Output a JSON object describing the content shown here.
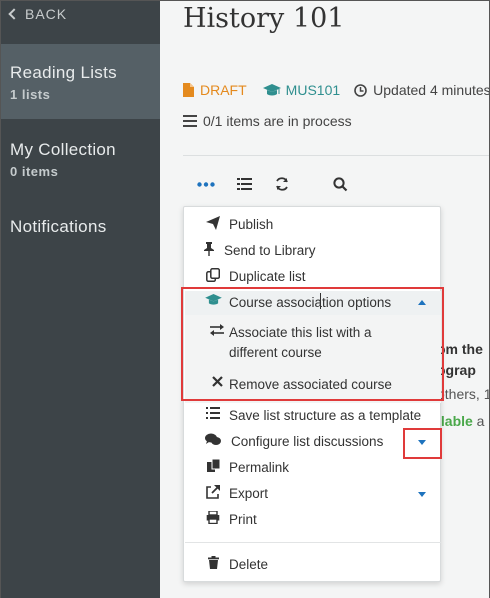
{
  "sidebar": {
    "back_label": "BACK",
    "items": [
      {
        "title": "Reading Lists",
        "sub": "1 lists"
      },
      {
        "title": "My Collection",
        "sub": "0 items"
      },
      {
        "title": "Notifications",
        "sub": ""
      }
    ]
  },
  "page": {
    "title": "History 101",
    "status": "DRAFT",
    "course_code": "MUS101",
    "updated": "Updated 4 minutes",
    "process_text": "0/1 items are in process"
  },
  "behind_text": {
    "line1": "om the",
    "line2": "ograp",
    "line3": "others, 1",
    "line4a": "ilable",
    "line4b": " a"
  },
  "menu": {
    "publish": "Publish",
    "send_to_library": "Send to Library",
    "duplicate_list": "Duplicate list",
    "course_association_options": "Course association options",
    "associate_line1": "Associate this list with a",
    "associate_line2": "different course",
    "remove_course": "Remove associated course",
    "save_template": "Save list structure as a template",
    "configure_discussions": "Configure list discussions",
    "permalink": "Permalink",
    "export": "Export",
    "print": "Print",
    "delete": "Delete"
  },
  "colors": {
    "sidebar_bg": "#3d4448",
    "sidebar_active": "#556066",
    "draft_orange": "#e48a1e",
    "course_teal": "#2f8f8f",
    "accent_blue": "#1e73be",
    "highlight_red": "#e03a3a"
  },
  "icons": [
    "chevron-left-icon",
    "file-icon",
    "graduation-cap-icon",
    "clock-icon",
    "list-icon",
    "ellipsis-icon",
    "refresh-icon",
    "search-icon",
    "paper-plane-icon",
    "pin-icon",
    "copy-icon",
    "exchange-icon",
    "times-icon",
    "list-ol-icon",
    "comments-icon",
    "link-icon",
    "share-icon",
    "print-icon",
    "trash-icon",
    "caret-up-icon",
    "caret-down-icon"
  ]
}
